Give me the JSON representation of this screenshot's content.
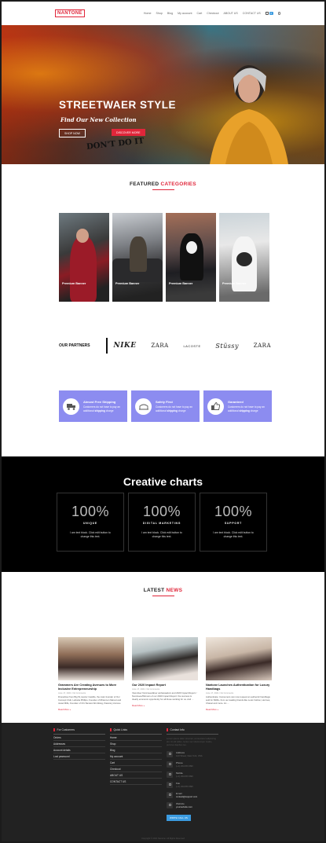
{
  "brand": {
    "logo": "NANTONE",
    "accent": "#e0263a",
    "feature_color": "#8c8cf0",
    "link_blue": "#3b9be0"
  },
  "nav": {
    "items": [
      "Home",
      "Shop",
      "Blog",
      "My account",
      "Cart",
      "Checkout",
      "ABOUT US",
      "CONTACT US"
    ],
    "cart_count": "0",
    "icons": [
      "bag-icon",
      "search-icon"
    ]
  },
  "hero": {
    "title": "STREETWAER STYLE",
    "tagline": "Find Our New Collection",
    "btn_primary": "SHOP NOW",
    "btn_secondary": "DISCOVER MORE",
    "graffiti": "DON'T DO IT"
  },
  "categories": {
    "title_a": "FEATURED",
    "title_b": "CATEGORIES",
    "items": [
      "Premium Banner",
      "Premium Banner",
      "Premium Banner",
      "Premium Banner"
    ]
  },
  "partners": {
    "title": "OUR PARTNERS",
    "logos": [
      "NIKE",
      "ZARA",
      "LACOSTE",
      "Stüssy",
      "ZARA"
    ]
  },
  "features": [
    {
      "icon": "truck-icon",
      "title": "Almost Free Shipping",
      "line1": "Customers do not have to pay an",
      "line2": "additional",
      "bold": "shipping",
      "line3": "charge"
    },
    {
      "icon": "shield-icon",
      "title": "Safety First",
      "line1": "Customers do not have to pay an",
      "line2": "additional",
      "bold": "shipping",
      "line3": "charge"
    },
    {
      "icon": "thumbs-up-icon",
      "title": "Garanteed",
      "line1": "Customers do not have to pay an",
      "line2": "additional",
      "bold": "shipping",
      "line3": "charge"
    }
  ],
  "charts": {
    "title": "Creative charts",
    "items": [
      {
        "value": "100%",
        "name": "UNIQUE",
        "desc1": "I am text block. Click edit button to",
        "desc2": "change this text."
      },
      {
        "value": "100%",
        "name": "DIGITAL MARKETING",
        "desc1": "I am text block. Click edit button to",
        "desc2": "change this text."
      },
      {
        "value": "100%",
        "name": "SUPPORT",
        "desc1": "I am text block. Click edit button to",
        "desc2": "change this text."
      }
    ]
  },
  "news": {
    "title_a": "LATEST",
    "title_b": "NEWS",
    "items": [
      {
        "title": "Grammers Are Creating Avenues to More Inclusive Entrepreneurship",
        "meta": "June 17, 2021 / No Comments",
        "excerpt": "Droneblow from Big W, Hector Castillo, the main founder of Our Concept Club, LaFaria Phillips, Founder of Rhiannon Marvel and Jewel Mills, Founder of Chi-Tamara Wu-Wang, Kiaranny Ancone",
        "more": "Read More »"
      },
      {
        "title": "Our 2020 Impact Report",
        "meta": "June 17, 2021 / No Comments",
        "excerpt": "View Ever Nominees/Ever ambassadors and 2020 Impact Report / Nominees/Winners of our 2020 Impact Report: the success is clearly economic opportunity for all those working for us. And ...",
        "more": "Read More »"
      },
      {
        "title": "Nantone Launches Authentication for Luxury Handbags",
        "meta": "June 17, 2021 / No Comments",
        "excerpt": "Authenticate: Consumers can now request an authentic handbags sold for $300+ from our leading brands like Louis Vuitton, Hermes, Chanel and more. An ...",
        "more": "Read More »"
      }
    ]
  },
  "footer": {
    "customers_title": "For Customers",
    "customers": [
      "Orders",
      "Addresses",
      "Account details",
      "Lost password"
    ],
    "links_title": "Quick Links",
    "links": [
      "Home",
      "Shop",
      "Blog",
      "My account",
      "Cart",
      "Checkout",
      "ABOUT US",
      "CONTACT US"
    ],
    "contact_title": "Contact Info",
    "contact_blurb": "Lorem ipsum dolor sit amet, consectetur adipiscing elit. Ut elit tellus, luctus nec ullamcorper mattis, pulvinar dapibus leo.",
    "contacts": [
      {
        "icon": "map-pin-icon",
        "label": "Address",
        "value": "123 Street, New York, USA"
      },
      {
        "icon": "phone-icon",
        "label": "Phone",
        "value": "(+1) 234-567-890"
      },
      {
        "icon": "mobile-icon",
        "label": "Mobile",
        "value": "(+1) 234-567-890"
      },
      {
        "icon": "fax-icon",
        "label": "Fax",
        "value": "(+1) 234-567-890"
      },
      {
        "icon": "mail-icon",
        "label": "Email",
        "value": "contact@support.com"
      },
      {
        "icon": "globe-icon",
        "label": "Website",
        "value": "yourwebsite.com"
      }
    ],
    "cta": "WRITE CALL US",
    "copyright": "Copyright © 2021 Nantone. All Rights Reserved"
  }
}
